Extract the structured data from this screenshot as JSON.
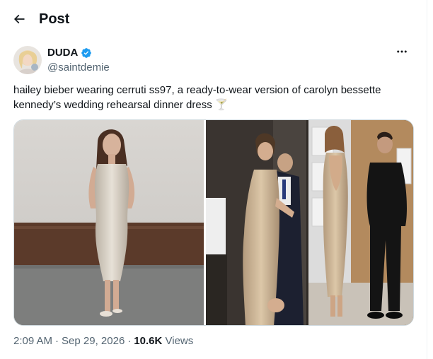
{
  "header": {
    "title": "Post",
    "back_icon": "arrow-left-icon"
  },
  "author": {
    "name": "DUDA",
    "handle": "@saintdemie",
    "verified": true,
    "verified_color": "#1d9bf0",
    "avatar_icon": "avatar-photo"
  },
  "more_icon": "more-horizontal-icon",
  "tweet": {
    "text": "hailey bieber wearing cerruti ss97, a ready-to-wear version of carolyn bessette kennedy’s wedding rehearsal dinner dress 🍸"
  },
  "media": [
    {
      "description": "photo-hailey-dress"
    },
    {
      "description": "photo-carolyn-dress"
    }
  ],
  "meta": {
    "time": "2:09 AM",
    "date": "Sep 29, 2026",
    "views_count": "10.6K",
    "views_label": "Views",
    "separator": "·"
  },
  "colors": {
    "text": "#0f1419",
    "secondary": "#536471",
    "accent": "#1d9bf0",
    "border": "#cfd9de"
  }
}
